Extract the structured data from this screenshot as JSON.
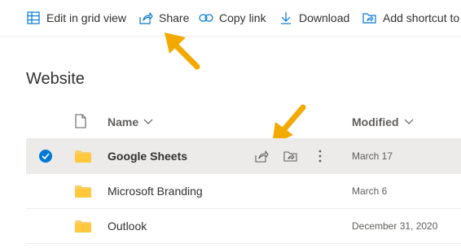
{
  "toolbar": {
    "edit_grid": {
      "label": "Edit in grid view",
      "icon": "grid-icon"
    },
    "share": {
      "label": "Share",
      "icon": "share-icon"
    },
    "copy_link": {
      "label": "Copy link",
      "icon": "link-icon"
    },
    "download": {
      "label": "Download",
      "icon": "download-icon"
    },
    "add_shortcut": {
      "label": "Add shortcut to",
      "icon": "shortcut-icon"
    }
  },
  "page": {
    "title": "Website"
  },
  "list": {
    "columns": {
      "name": "Name",
      "modified": "Modified"
    },
    "rows": [
      {
        "name": "Google Sheets",
        "modified": "March 17",
        "selected": true
      },
      {
        "name": "Microsoft Branding",
        "modified": "March 6",
        "selected": false
      },
      {
        "name": "Outlook",
        "modified": "December 31, 2020",
        "selected": false
      }
    ]
  },
  "colors": {
    "accent": "#0078d4",
    "folder": "#f8d06a",
    "arrow": "#f2a900",
    "selected_row": "#edebe9"
  }
}
